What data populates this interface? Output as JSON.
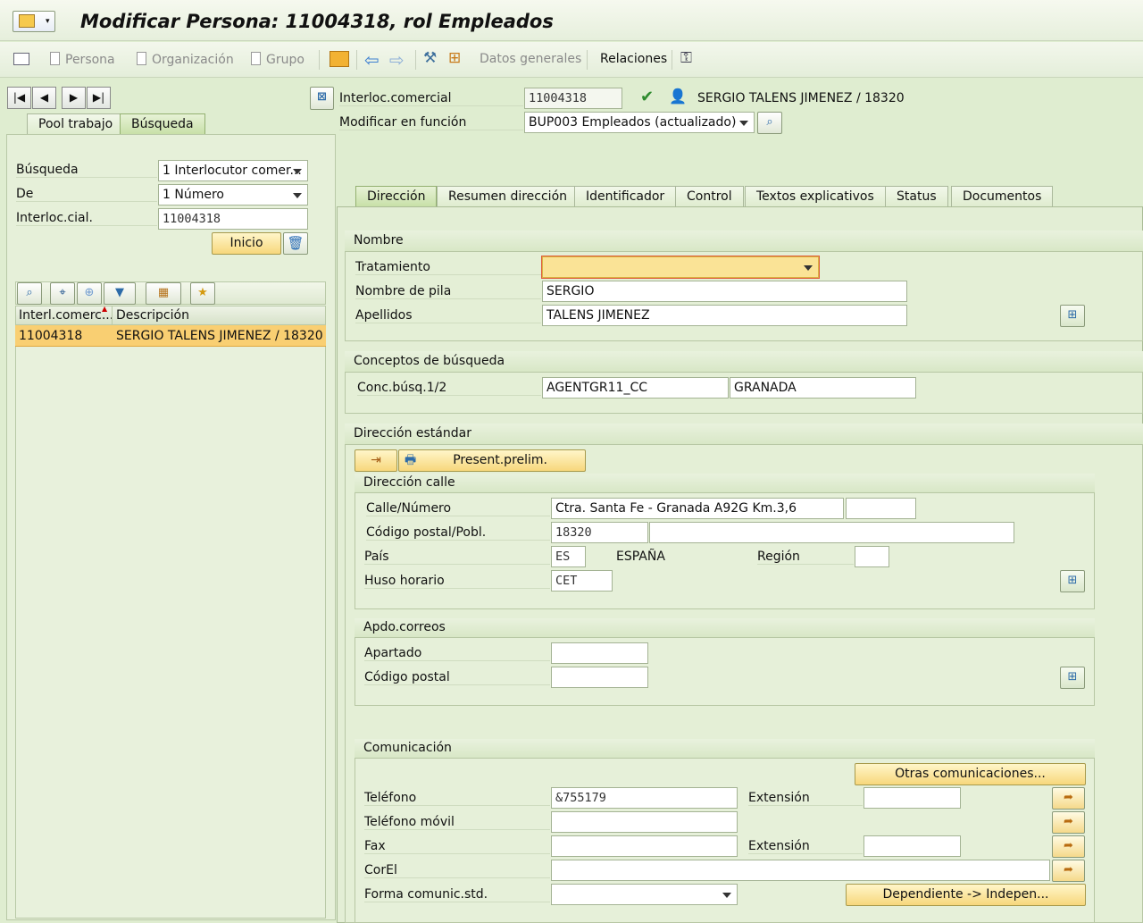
{
  "window": {
    "title": "Modificar Persona: 11004318, rol Empleados"
  },
  "toolbar": {
    "persona": "Persona",
    "organizacion": "Organización",
    "grupo": "Grupo",
    "datos_generales": "Datos generales",
    "relaciones": "Relaciones"
  },
  "locator": {
    "tabs": [
      "Pool trabajo",
      "Búsqueda"
    ],
    "busqueda_label": "Búsqueda",
    "busqueda_value": "1 Interlocutor comer...",
    "de_label": "De",
    "de_value": "1 Número",
    "interloc_label": "Interloc.cial.",
    "interloc_value": "11004318",
    "inicio_button": "Inicio",
    "table": {
      "columns": [
        "Interl.comerc...",
        "Descripción"
      ],
      "rows": [
        [
          "11004318",
          "SERGIO TALENS JIMENEZ / 18320"
        ]
      ]
    }
  },
  "header": {
    "interloc_label": "Interloc.comercial",
    "interloc_value": "11004318",
    "partner_name": "SERGIO TALENS JIMENEZ / 18320",
    "funcion_label": "Modificar en función",
    "funcion_value": "BUP003 Empleados (actualizado)"
  },
  "tabs": [
    "Dirección",
    "Resumen dirección",
    "Identificador",
    "Control",
    "Textos explicativos",
    "Status",
    "Documentos"
  ],
  "nombre": {
    "title": "Nombre",
    "tratamiento_label": "Tratamiento",
    "tratamiento_value": "",
    "nombre_label": "Nombre de pila",
    "nombre_value": "SERGIO",
    "apellidos_label": "Apellidos",
    "apellidos_value": "TALENS JIMENEZ"
  },
  "conceptos": {
    "title": "Conceptos de búsqueda",
    "label": "Conc.búsq.1/2",
    "value1": "AGENTGR11_CC",
    "value2": "GRANADA"
  },
  "direccion": {
    "title": "Dirección estándar",
    "preview_button": "Present.prelim.",
    "calle_title": "Dirección calle",
    "calle_label": "Calle/Número",
    "calle_value": "Ctra. Santa Fe - Granada A92G Km.3,6",
    "numero_value": "",
    "cp_label": "Código postal/Pobl.",
    "cp_value": "18320",
    "poblacion_value": "",
    "pais_label": "País",
    "pais_value": "ES",
    "pais_name": "ESPAÑA",
    "region_label": "Región",
    "region_value": "",
    "huso_label": "Huso horario",
    "huso_value": "CET"
  },
  "apdo": {
    "title": "Apdo.correos",
    "apartado_label": "Apartado",
    "apartado_value": "",
    "cp_label": "Código postal",
    "cp_value": ""
  },
  "comunicacion": {
    "title": "Comunicación",
    "otras_button": "Otras comunicaciones...",
    "telefono_label": "Teléfono",
    "telefono_value": "&755179",
    "extension_label": "Extensión",
    "extension_value": "",
    "movil_label": "Teléfono móvil",
    "movil_value": "",
    "fax_label": "Fax",
    "fax_value": "",
    "fax_ext_label": "Extensión",
    "fax_ext_value": "",
    "correo_label": "CorEl",
    "correo_value": "",
    "forma_label": "Forma comunic.std.",
    "forma_value": "",
    "dependiente_button": "Dependiente -> Indepen..."
  }
}
